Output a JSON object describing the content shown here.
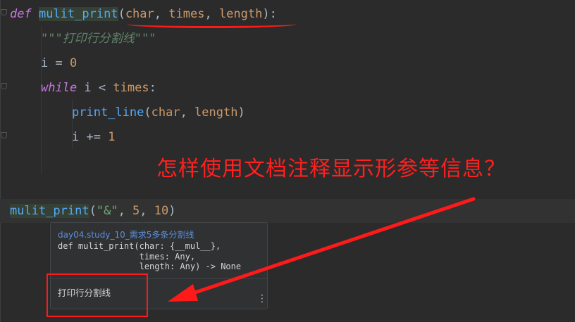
{
  "code": {
    "line1": {
      "kw": "def",
      "fn": "mulit_print",
      "open": "(",
      "p1": "char",
      "c1": ", ",
      "p2": "times",
      "c2": ", ",
      "p3": "length",
      "close": "):"
    },
    "line2": {
      "doc": "\"\"\"打印行分割线\"\"\""
    },
    "line3": {
      "var": "i = ",
      "num": "0"
    },
    "line4": {
      "kw": "while",
      "mid": " i < ",
      "param": "times",
      "end": ":"
    },
    "line5": {
      "fn": "print_line",
      "open": "(",
      "p1": "char",
      "c1": ", ",
      "p2": "length",
      "close": ")"
    },
    "line6": {
      "var": "i += ",
      "num": "1"
    },
    "line7": {
      "fn": "mulit_print",
      "open": "(",
      "str": "\"&\"",
      "c1": ", ",
      "n1": "5",
      "c2": ", ",
      "n2": "10",
      "close": ")"
    }
  },
  "annotation": {
    "question": "怎样使用文档注释显示形参等信息？",
    "color": "#ff1a1a"
  },
  "popup": {
    "header": "day04.study_10_需求5多条分割线",
    "signature": "def mulit_print(char: {__mul__},\n                times: Any,\n                length: Any) -> None",
    "doc": "打印行分割线",
    "menu_icon": "⋮"
  }
}
